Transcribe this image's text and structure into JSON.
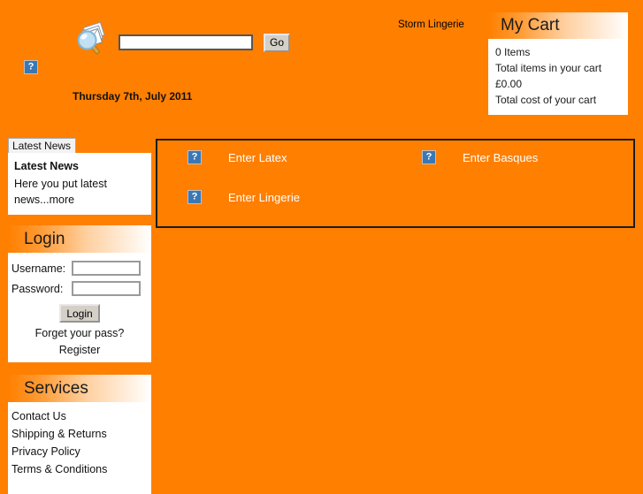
{
  "page": {
    "background_color": "#ff7f00",
    "accent_color": "#ff8000"
  },
  "header": {
    "search": {
      "icon_name": "magnifier-documents-icon",
      "input_value": "",
      "placeholder": "",
      "go_label": "Go"
    },
    "broken_image_icon": "broken-image-placeholder",
    "date": "Thursday 7th, July 2011",
    "site_name": "Storm Lingerie"
  },
  "cart": {
    "title": "My Cart",
    "lines": [
      "0 Items",
      "Total items in your cart",
      "£0.00",
      "Total cost of your cart"
    ]
  },
  "news": {
    "tab_label": "Latest News",
    "title": "Latest News",
    "text": "Here you put latest news...more"
  },
  "login": {
    "title": "Login",
    "username_label": "Username:",
    "username_value": "",
    "password_label": "Password:",
    "password_value": "",
    "button_label": "Login",
    "forgot_label": "Forget your pass?",
    "register_label": "Register"
  },
  "services": {
    "title": "Services",
    "items": [
      "Contact Us",
      "Shipping & Returns",
      "Privacy Policy",
      "Terms & Conditions"
    ]
  },
  "main": {
    "entries": [
      {
        "label": "Enter Latex",
        "icon": "broken-image-placeholder"
      },
      {
        "label": "Enter Basques",
        "icon": "broken-image-placeholder"
      },
      {
        "label": "Enter Lingerie",
        "icon": "broken-image-placeholder"
      }
    ]
  }
}
